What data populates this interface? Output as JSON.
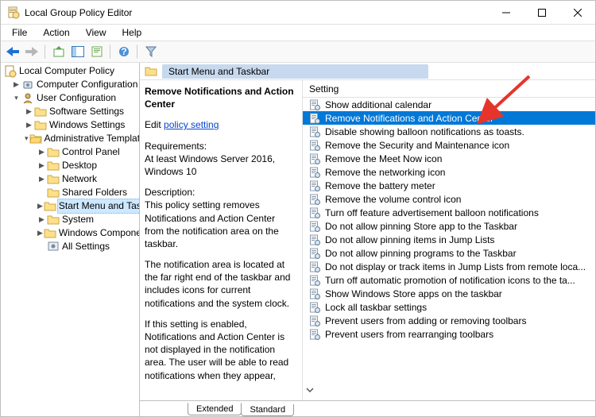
{
  "window": {
    "title": "Local Group Policy Editor"
  },
  "menu": {
    "file": "File",
    "action": "Action",
    "view": "View",
    "help": "Help"
  },
  "tree": {
    "root": "Local Computer Policy",
    "cc": "Computer Configuration",
    "uc": "User Configuration",
    "sw": "Software Settings",
    "ws": "Windows Settings",
    "at": "Administrative Templates",
    "cp": "Control Panel",
    "dt": "Desktop",
    "nw": "Network",
    "sf": "Shared Folders",
    "sm": "Start Menu and Taskbar",
    "sy": "System",
    "wc": "Windows Components",
    "as": "All Settings"
  },
  "content": {
    "heading": "Start Menu and Taskbar",
    "selected_title": "Remove Notifications and Action Center",
    "edit_prefix": "Edit ",
    "edit_link": "policy setting",
    "req_label": "Requirements:",
    "req_text": "At least Windows Server 2016, Windows 10",
    "desc_label": "Description:",
    "desc1": "This policy setting removes Notifications and Action Center from the notification area on the taskbar.",
    "desc2": "The notification area is located at the far right end of the taskbar and includes icons for current notifications and the system clock.",
    "desc3": "If this setting is enabled, Notifications and Action Center is not displayed in the notification area. The user will be able to read notifications when they appear,"
  },
  "list": {
    "header": "Setting",
    "items": [
      "Show additional calendar",
      "Remove Notifications and Action Center",
      "Disable showing balloon notifications as toasts.",
      "Remove the Security and Maintenance icon",
      "Remove the Meet Now icon",
      "Remove the networking icon",
      "Remove the battery meter",
      "Remove the volume control icon",
      "Turn off feature advertisement balloon notifications",
      "Do not allow pinning Store app to the Taskbar",
      "Do not allow pinning items in Jump Lists",
      "Do not allow pinning programs to the Taskbar",
      "Do not display or track items in Jump Lists from remote loca...",
      "Turn off automatic promotion of notification icons to the ta...",
      "Show Windows Store apps on the taskbar",
      "Lock all taskbar settings",
      "Prevent users from adding or removing toolbars",
      "Prevent users from rearranging toolbars"
    ],
    "selected_index": 1
  },
  "tabs": {
    "extended": "Extended",
    "standard": "Standard"
  }
}
